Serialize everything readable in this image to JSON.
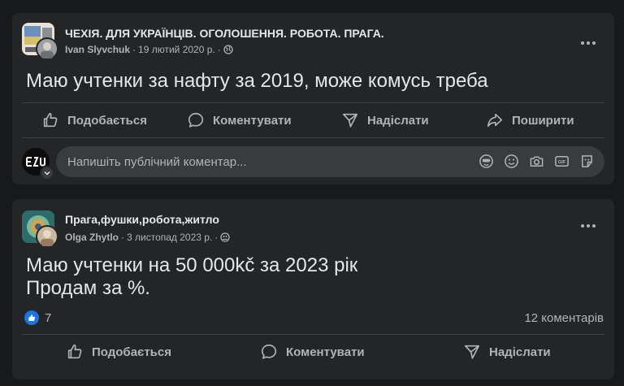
{
  "posts": [
    {
      "group_name": "ЧЕХІЯ. ДЛЯ УКРАЇНЦІВ. ОГОЛОШЕННЯ. РОБОТА. ПРАГА.",
      "author": "Ivan Slyvchuk",
      "separator": "·",
      "date": "19 лютий 2020 р.",
      "audience_icon": "globe-icon",
      "text": "Маю учтенки за нафту за 2019, може комусь треба",
      "actions": {
        "like": "Подобається",
        "comment": "Коментувати",
        "send": "Надіслати",
        "share": "Поширити"
      },
      "comment_placeholder": "Напишіть публічний коментар..."
    },
    {
      "group_name": "Прага,фушки,робота,житло",
      "author": "Olga Zhytlo",
      "separator": "·",
      "date": "3 листопад 2023 р.",
      "audience_icon": "group-icon",
      "text_lines": [
        "Маю учтенки на 50 000kč за 2023 рік",
        "Продам за %."
      ],
      "reactions_count": "7",
      "comments_count": "12 коментарів",
      "actions": {
        "like": "Подобається",
        "comment": "Коментувати",
        "send": "Надіслати"
      }
    }
  ],
  "colors": {
    "background": "#18191a",
    "card": "#242526",
    "text": "#e4e6eb",
    "secondary": "#b0b3b8",
    "like_blue": "#1b74e4"
  }
}
